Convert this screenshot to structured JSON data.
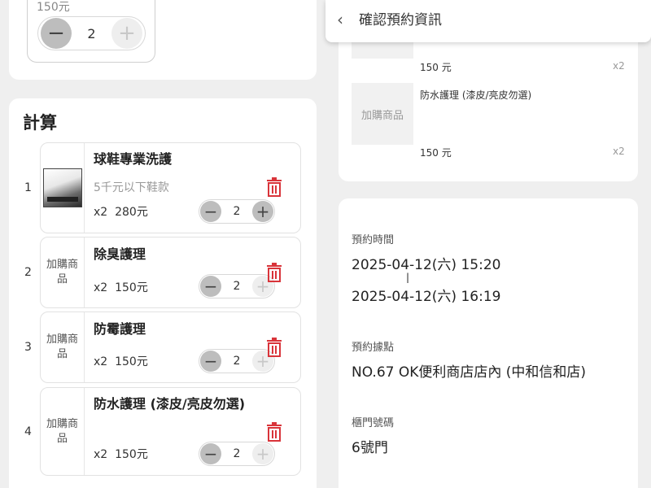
{
  "top_item": {
    "price": "150元",
    "qty": "2"
  },
  "calc": {
    "title": "計算",
    "rows": [
      {
        "index": "1",
        "thumb_icon": "sneaker-wash-thumbnail",
        "name": "球鞋專業洗護",
        "sub": "5千元以下鞋款",
        "qty_prefix": "x2",
        "price": "280元",
        "qty": "2",
        "plus_active": true
      },
      {
        "index": "2",
        "thumb_text": "加購商品",
        "name": "除臭護理",
        "qty_prefix": "x2",
        "price": "150元",
        "qty": "2"
      },
      {
        "index": "3",
        "thumb_text": "加購商品",
        "name": "防霉護理",
        "qty_prefix": "x2",
        "price": "150元",
        "qty": "2"
      },
      {
        "index": "4",
        "thumb_text": "加購商品",
        "name": "防水護理 (漆皮/亮皮勿選)",
        "qty_prefix": "x2",
        "price": "150元",
        "qty": "2"
      }
    ]
  },
  "header": {
    "title": "確認預約資訊",
    "back_icon": "chevron-left-icon"
  },
  "order": {
    "items": [
      {
        "price": "150 元",
        "qty": "x2"
      },
      {
        "thumb_text": "加購商品",
        "name": "防水護理 (漆皮/亮皮勿選)",
        "price": "150 元",
        "qty": "x2"
      }
    ]
  },
  "info": {
    "time_label": "預約時間",
    "time_start": "2025-04-12(六) 15:20",
    "time_sep": "|",
    "time_end": "2025-04-12(六) 16:19",
    "location_label": "預約據點",
    "location_value": "NO.67 OK便利商店店內 (中和信和店)",
    "locker_label": "櫃門號碼",
    "locker_value": "6號門"
  },
  "colors": {
    "trash": "#d9343a",
    "background": "#efefef"
  }
}
